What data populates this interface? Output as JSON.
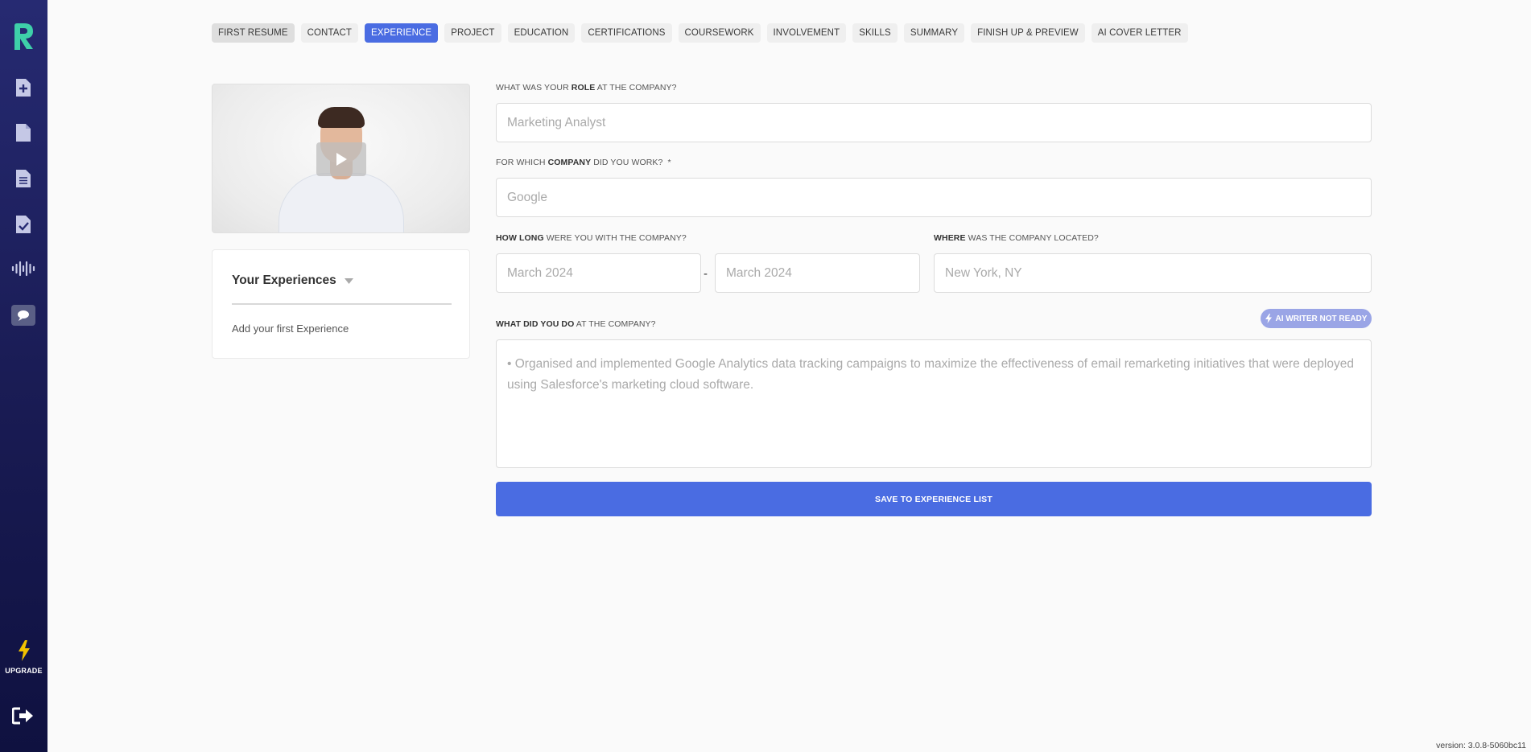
{
  "colors": {
    "accent": "#4a6ce2",
    "sidebar": "#1a1c55",
    "logo": "#3ecfa9",
    "upgrade": "#f2c200"
  },
  "sidebar": {
    "logo_icon": "resume-logo-icon",
    "icons": [
      "new-document-icon",
      "document-icon",
      "document-lines-icon",
      "document-check-icon",
      "audio-wave-icon",
      "chat-icon"
    ],
    "upgrade_label": "UPGRADE",
    "logout_icon": "logout-icon"
  },
  "tabs": [
    {
      "label": "FIRST RESUME",
      "state": "muted"
    },
    {
      "label": "CONTACT",
      "state": "normal"
    },
    {
      "label": "EXPERIENCE",
      "state": "active"
    },
    {
      "label": "PROJECT",
      "state": "normal"
    },
    {
      "label": "EDUCATION",
      "state": "normal"
    },
    {
      "label": "CERTIFICATIONS",
      "state": "normal"
    },
    {
      "label": "COURSEWORK",
      "state": "normal"
    },
    {
      "label": "INVOLVEMENT",
      "state": "normal"
    },
    {
      "label": "SKILLS",
      "state": "normal"
    },
    {
      "label": "SUMMARY",
      "state": "normal"
    },
    {
      "label": "FINISH UP & PREVIEW",
      "state": "normal"
    },
    {
      "label": "AI COVER LETTER",
      "state": "normal"
    }
  ],
  "experiences": {
    "title": "Your Experiences",
    "empty_text": "Add your first Experience"
  },
  "form": {
    "role_label": {
      "pre": "WHAT WAS YOUR ",
      "bold": "ROLE",
      "post": " AT THE COMPANY?"
    },
    "role_placeholder": "Marketing Analyst",
    "role_value": "",
    "company_label": {
      "pre": "FOR WHICH ",
      "bold": "COMPANY",
      "post": " DID YOU WORK?",
      "required": "*"
    },
    "company_placeholder": "Google",
    "company_value": "",
    "duration_label": {
      "bold": "HOW LONG",
      "post": " WERE YOU WITH THE COMPANY?"
    },
    "start_placeholder": "March 2024",
    "end_placeholder": "March 2024",
    "date_separator": "-",
    "location_label": {
      "bold": "WHERE",
      "post": " WAS THE COMPANY LOCATED?"
    },
    "location_placeholder": "New York, NY",
    "duties_label": {
      "bold": "WHAT DID YOU DO",
      "post": " AT THE COMPANY?"
    },
    "ai_badge": "AI WRITER NOT READY",
    "duties_placeholder": "• Organised and implemented Google Analytics data tracking campaigns to maximize the effectiveness of email remarketing initiatives that were deployed using Salesforce's marketing cloud software.",
    "save_label": "SAVE TO EXPERIENCE LIST"
  },
  "version": "version: 3.0.8-5060bc11"
}
